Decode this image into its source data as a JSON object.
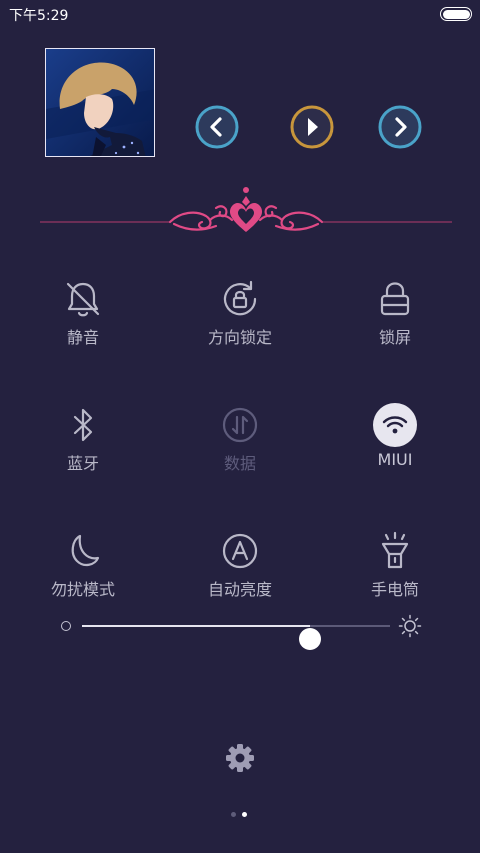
{
  "status_bar": {
    "time": "下午5:29",
    "battery_level": 1.0
  },
  "music": {
    "album_art": "album-art",
    "prev_icon": "chevron-left-icon",
    "play_icon": "play-icon",
    "next_icon": "chevron-right-icon"
  },
  "toggles": [
    {
      "label": "静音",
      "icon": "bell-off-icon",
      "state": "off"
    },
    {
      "label": "方向锁定",
      "icon": "rotation-lock-icon",
      "state": "off"
    },
    {
      "label": "锁屏",
      "icon": "lock-icon",
      "state": "off"
    },
    {
      "label": "蓝牙",
      "icon": "bluetooth-icon",
      "state": "off"
    },
    {
      "label": "数据",
      "icon": "data-icon",
      "state": "disabled"
    },
    {
      "label": "MIUI",
      "icon": "wifi-icon",
      "state": "on"
    },
    {
      "label": "勿扰模式",
      "icon": "moon-icon",
      "state": "off"
    },
    {
      "label": "自动亮度",
      "icon": "auto-brightness-icon",
      "state": "off"
    },
    {
      "label": "手电筒",
      "icon": "flashlight-icon",
      "state": "off"
    }
  ],
  "brightness": {
    "level": 0.74
  },
  "pager": {
    "count": 2,
    "active": 2
  },
  "colors": {
    "background": "#24213f",
    "accent_gold": "#c8963c",
    "accent_cyan": "#4aa3c9",
    "ornament_pink": "#e04a86"
  }
}
